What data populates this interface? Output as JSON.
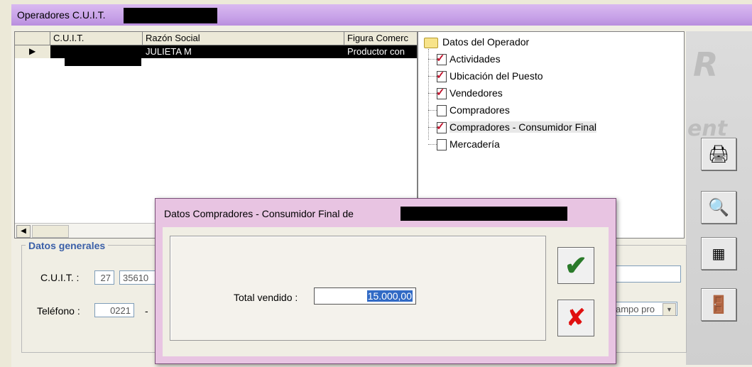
{
  "window": {
    "title": "Operadores C.U.I.T."
  },
  "grid": {
    "columns": [
      "C.U.I.T.",
      "Razón Social",
      "Figura Comerc"
    ],
    "rows": [
      {
        "razon_social": "JULIETA M",
        "figura": "Productor con"
      }
    ]
  },
  "tree": {
    "root": "Datos del Operador",
    "items": [
      {
        "label": "Actividades",
        "checked": true
      },
      {
        "label": "Ubicación del Puesto",
        "checked": true
      },
      {
        "label": "Vendedores",
        "checked": true
      },
      {
        "label": "Compradores",
        "checked": false
      },
      {
        "label": "Compradores - Consumidor Final",
        "checked": true
      },
      {
        "label": "Mercadería",
        "checked": false
      }
    ]
  },
  "datos_generales": {
    "title": "Datos generales",
    "cuit_label": "C.U.I.T. :",
    "cuit_prefix": "27",
    "cuit_number": "35610",
    "telefono_label": "Teléfono :",
    "telefono_area": "0221",
    "telefono_sep": "-",
    "combo_value": "ampo pro"
  },
  "dialog": {
    "title": "Datos Compradores - Consumidor Final de",
    "total_label": "Total vendido :",
    "total_value": "15.000,00",
    "ok_icon": "checkmark-icon",
    "cancel_icon": "x-icon"
  },
  "side_panel": {
    "buttons": [
      "printer-icon",
      "search-document-icon",
      "windows-icon",
      "exit-door-icon"
    ]
  }
}
